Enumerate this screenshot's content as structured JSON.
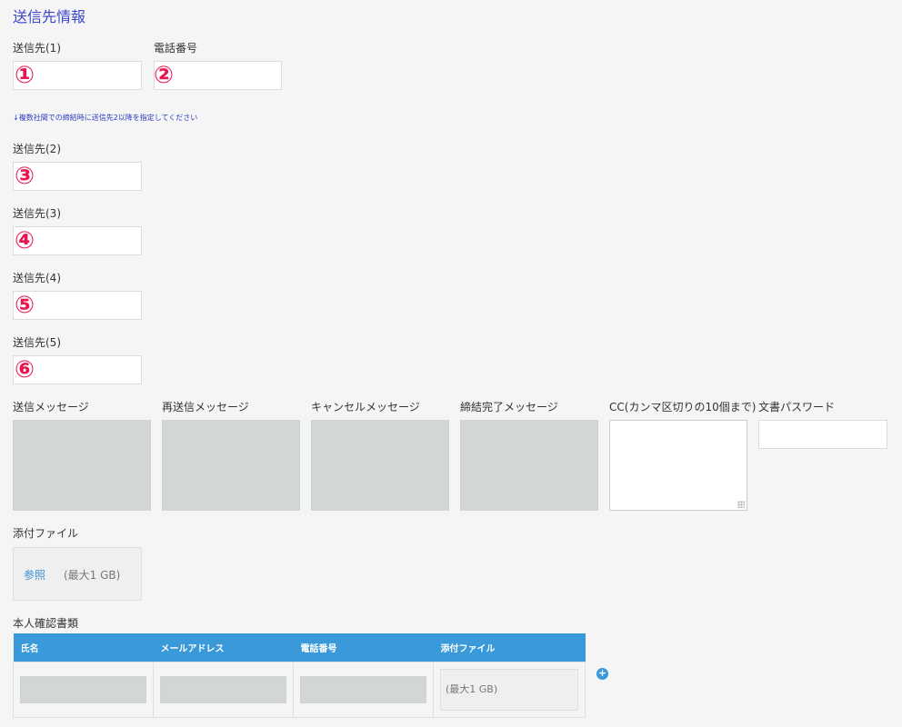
{
  "section_title": "送信先情報",
  "recipient1": {
    "label": "送信先(1)",
    "marker": "①"
  },
  "phone": {
    "label": "電話番号",
    "marker": "②"
  },
  "hint": "↓複数社間での締結時に送信先2以降を指定してください",
  "recipient2": {
    "label": "送信先(2)",
    "marker": "③"
  },
  "recipient3": {
    "label": "送信先(3)",
    "marker": "④"
  },
  "recipient4": {
    "label": "送信先(4)",
    "marker": "⑤"
  },
  "recipient5": {
    "label": "送信先(5)",
    "marker": "⑥"
  },
  "messages": {
    "send": "送信メッセージ",
    "resend": "再送信メッセージ",
    "cancel": "キャンセルメッセージ",
    "complete": "締結完了メッセージ",
    "cc": "CC(カンマ区切りの10個まで)",
    "password": "文書パスワード"
  },
  "attachment": {
    "label": "添付ファイル",
    "browse": "参照",
    "max": "(最大1 GB)"
  },
  "identity": {
    "label": "本人確認書類",
    "headers": [
      "氏名",
      "メールアドレス",
      "電話番号",
      "添付ファイル"
    ],
    "attach_max": "(最大1 GB)",
    "add_icon": "+"
  },
  "colors": {
    "title": "#3d46c9",
    "marker": "#e8174f",
    "table_header": "#3a9ad9",
    "link": "#3a8fd0"
  }
}
